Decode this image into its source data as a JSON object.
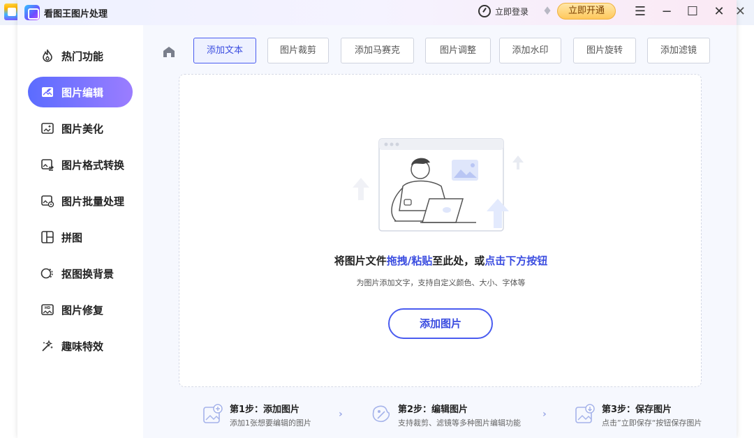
{
  "window": {
    "title": "看图王图片处理"
  },
  "header": {
    "login_label": "立即登录",
    "vip_button": "立即开通"
  },
  "sidebar": {
    "items": [
      {
        "label": "热门功能",
        "icon": "flame-icon",
        "active": false
      },
      {
        "label": "图片编辑",
        "icon": "image-edit-icon",
        "active": true
      },
      {
        "label": "图片美化",
        "icon": "image-sparkle-icon",
        "active": false
      },
      {
        "label": "图片格式转换",
        "icon": "image-convert-icon",
        "active": false
      },
      {
        "label": "图片批量处理",
        "icon": "image-batch-icon",
        "active": false
      },
      {
        "label": "拼图",
        "icon": "collage-icon",
        "active": false
      },
      {
        "label": "抠图换背景",
        "icon": "cutout-icon",
        "active": false
      },
      {
        "label": "图片修复",
        "icon": "hd-repair-icon",
        "active": false
      },
      {
        "label": "趣味特效",
        "icon": "magic-wand-icon",
        "active": false
      }
    ]
  },
  "toolbar": {
    "tabs": [
      "添加文本",
      "图片裁剪",
      "添加马赛克",
      "图片调整",
      "添加水印",
      "图片旋转",
      "添加滤镜"
    ],
    "active_index": 0
  },
  "dropzone": {
    "title_prefix": "将图片文件",
    "title_highlight1": "拖拽/粘贴",
    "title_middle": "至此处，或",
    "title_highlight2": "点击下方按钮",
    "subtitle": "为图片添加文字，支持自定义颜色、大小、字体等",
    "button": "添加图片"
  },
  "steps": [
    {
      "title": "第1步：添加图片",
      "desc": "添加1张想要编辑的图片"
    },
    {
      "title": "第2步：编辑图片",
      "desc": "支持裁剪、滤镜等多种图片编辑功能"
    },
    {
      "title": "第3步：保存图片",
      "desc": "点击”立即保存“按钮保存图片"
    }
  ],
  "colors": {
    "accent": "#4a5cf0",
    "active_gradient_start": "#5b6cff",
    "active_gradient_end": "#9b7dff",
    "vip_gold": "#ffc85c"
  }
}
